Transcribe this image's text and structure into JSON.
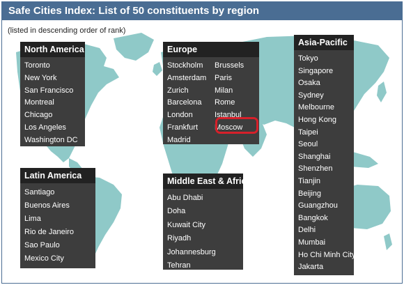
{
  "title": "Safe Cities Index: List of 50 constituents by region",
  "subtitle": "(listed in descending order of rank)",
  "colors": {
    "header": "#4a6d93",
    "box": "#3d3d3d",
    "box_head": "#222222",
    "land": "#8fc9c8",
    "highlight": "#d6202a"
  },
  "regions": {
    "north_america": {
      "name": "North America",
      "cities": [
        "Toronto",
        "New York",
        "San Francisco",
        "Montreal",
        "Chicago",
        "Los Angeles",
        "Washington DC"
      ]
    },
    "europe": {
      "name": "Europe",
      "col1": [
        "Stockholm",
        "Amsterdam",
        "Zurich",
        "Barcelona",
        "London",
        "Frankfurt",
        "Madrid"
      ],
      "col2": [
        "Brussels",
        "Paris",
        "Milan",
        "Rome",
        "Istanbul",
        "Moscow"
      ],
      "highlighted_city": "Moscow"
    },
    "asia_pacific": {
      "name": "Asia-Pacific",
      "cities": [
        "Tokyo",
        "Singapore",
        "Osaka",
        "Sydney",
        "Melbourne",
        "Hong Kong",
        "Taipei",
        "Seoul",
        "Shanghai",
        "Shenzhen",
        "Tianjin",
        "Beijing",
        "Guangzhou",
        "Bangkok",
        "Delhi",
        "Mumbai",
        "Ho Chi Minh City",
        "Jakarta"
      ]
    },
    "latin_america": {
      "name": "Latin America",
      "cities": [
        "Santiago",
        "Buenos Aires",
        "Lima",
        "Rio de Janeiro",
        "Sao Paulo",
        "Mexico City"
      ]
    },
    "middle_east_africa": {
      "name": "Middle East & Africa",
      "cities": [
        "Abu Dhabi",
        "Doha",
        "Kuwait City",
        "Riyadh",
        "Johannesburg",
        "Tehran"
      ]
    }
  }
}
